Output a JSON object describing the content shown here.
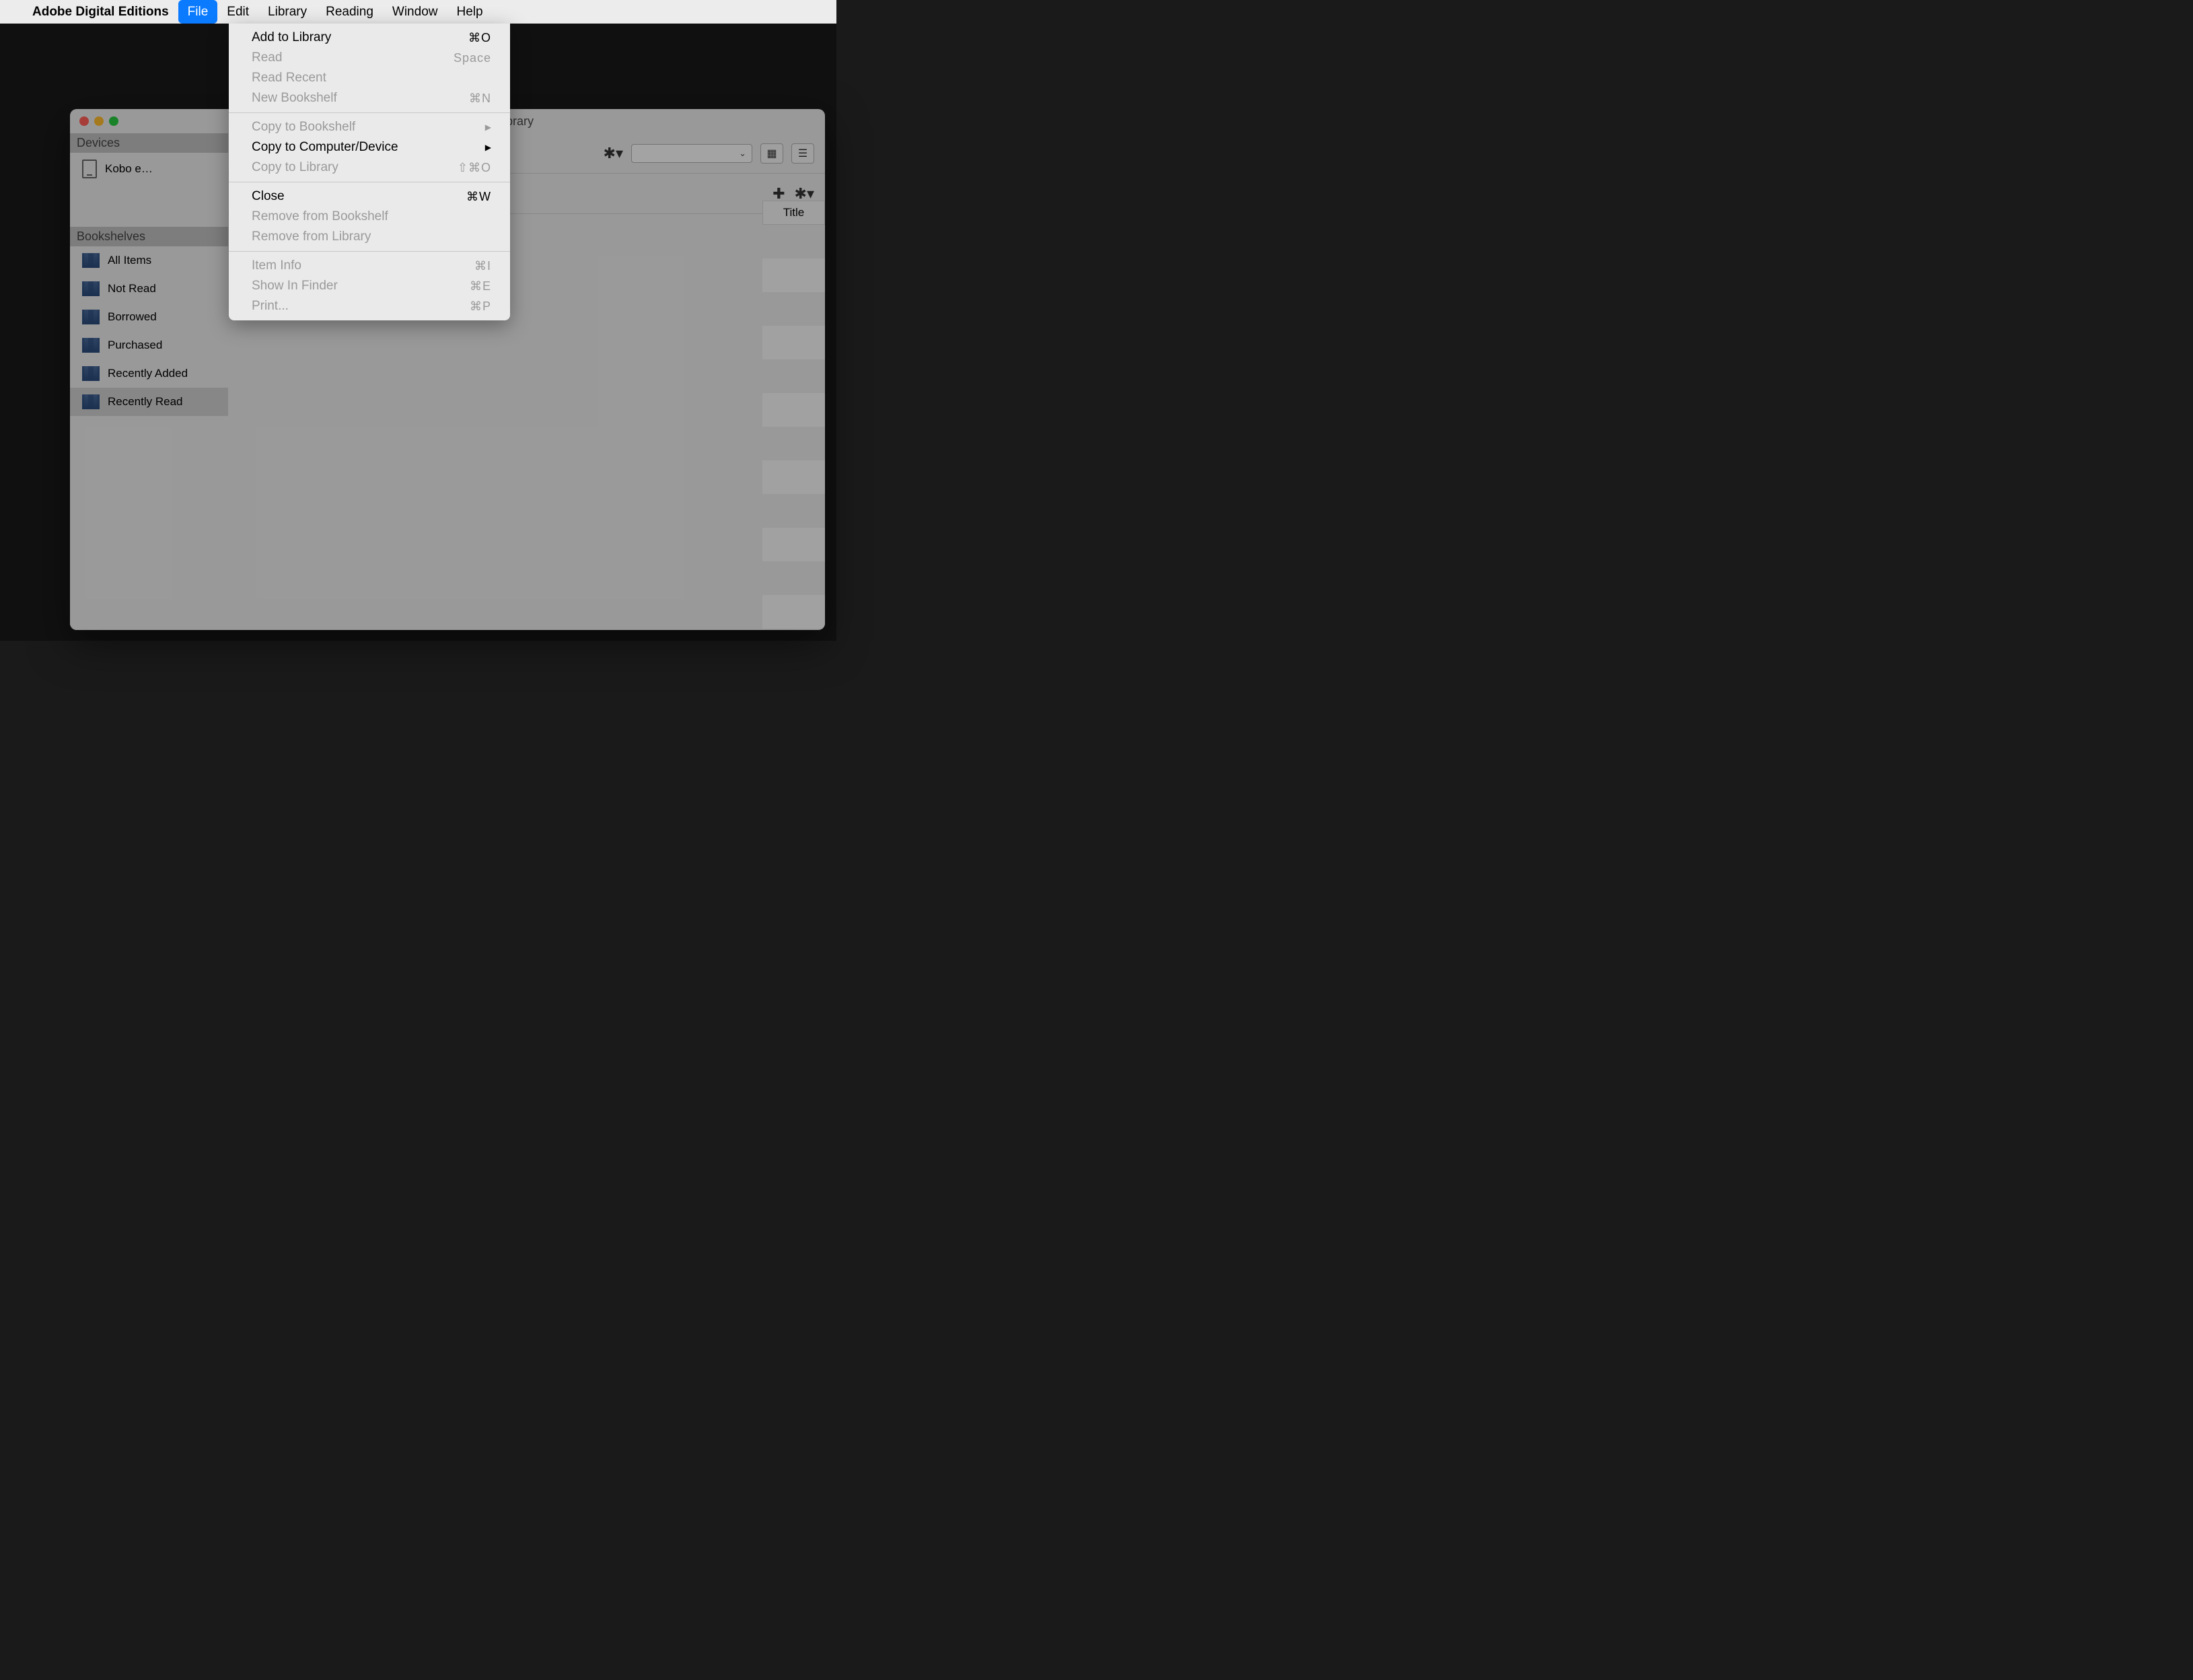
{
  "menubar": {
    "app_name": "Adobe Digital Editions",
    "items": [
      "File",
      "Edit",
      "Library",
      "Reading",
      "Window",
      "Help"
    ],
    "selected": "File"
  },
  "file_menu": {
    "groups": [
      [
        {
          "label": "Add to Library",
          "shortcut": "⌘O",
          "enabled": true
        },
        {
          "label": "Read",
          "shortcut": "Space",
          "enabled": false
        },
        {
          "label": "Read Recent",
          "shortcut": "",
          "enabled": false
        },
        {
          "label": "New Bookshelf",
          "shortcut": "⌘N",
          "enabled": false
        }
      ],
      [
        {
          "label": "Copy to Bookshelf",
          "shortcut": "",
          "submenu": true,
          "enabled": false
        },
        {
          "label": "Copy to Computer/Device",
          "shortcut": "",
          "submenu": true,
          "enabled": true
        },
        {
          "label": "Copy to Library",
          "shortcut": "⇧⌘O",
          "enabled": false
        }
      ],
      [
        {
          "label": "Close",
          "shortcut": "⌘W",
          "enabled": true
        },
        {
          "label": "Remove from Bookshelf",
          "shortcut": "",
          "enabled": false
        },
        {
          "label": "Remove from Library",
          "shortcut": "",
          "enabled": false
        }
      ],
      [
        {
          "label": "Item Info",
          "shortcut": "⌘I",
          "enabled": false
        },
        {
          "label": "Show In Finder",
          "shortcut": "⌘E",
          "enabled": false
        },
        {
          "label": "Print...",
          "shortcut": "⌘P",
          "enabled": false
        }
      ]
    ]
  },
  "window": {
    "title_suffix": "ibrary"
  },
  "sidebar": {
    "devices_header": "Devices",
    "devices": [
      {
        "label": "Kobo e…"
      }
    ],
    "bookshelves_header": "Bookshelves",
    "bookshelves": [
      {
        "label": "All Items"
      },
      {
        "label": "Not Read"
      },
      {
        "label": "Borrowed"
      },
      {
        "label": "Purchased"
      },
      {
        "label": "Recently Added"
      },
      {
        "label": "Recently Read"
      }
    ]
  },
  "table": {
    "columns": [
      "Title"
    ]
  }
}
